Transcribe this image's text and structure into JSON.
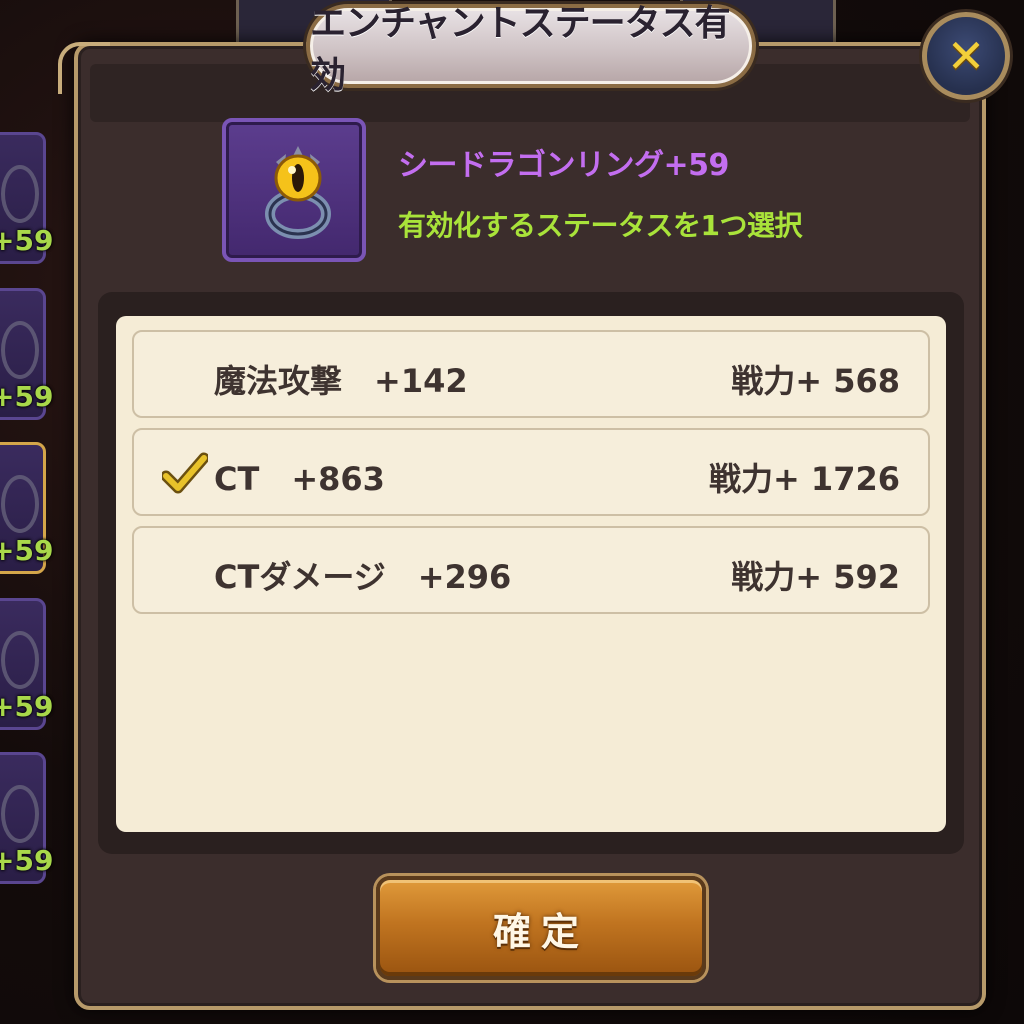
{
  "dialog": {
    "title": "エンチャントステータス有効",
    "close_label": "✕"
  },
  "item": {
    "name": "シードラゴンリング+59",
    "hint": "有効化するステータスを1つ選択",
    "icon": "ring-icon"
  },
  "stats": [
    {
      "name": "魔法攻撃　+142",
      "power": "戦力+ 568",
      "selected": false
    },
    {
      "name": "CT　+863",
      "power": "戦力+ 1726",
      "selected": true
    },
    {
      "name": "CTダメージ　+296",
      "power": "戦力+ 592",
      "selected": false
    }
  ],
  "confirm_label": "確定",
  "background_levels": [
    "+59",
    "+59",
    "+59",
    "+59",
    "+59"
  ],
  "colors": {
    "item_name": "#c36ef0",
    "hint": "#a9e33a",
    "check": "#e8c22a",
    "confirm_button": "#c07420"
  }
}
